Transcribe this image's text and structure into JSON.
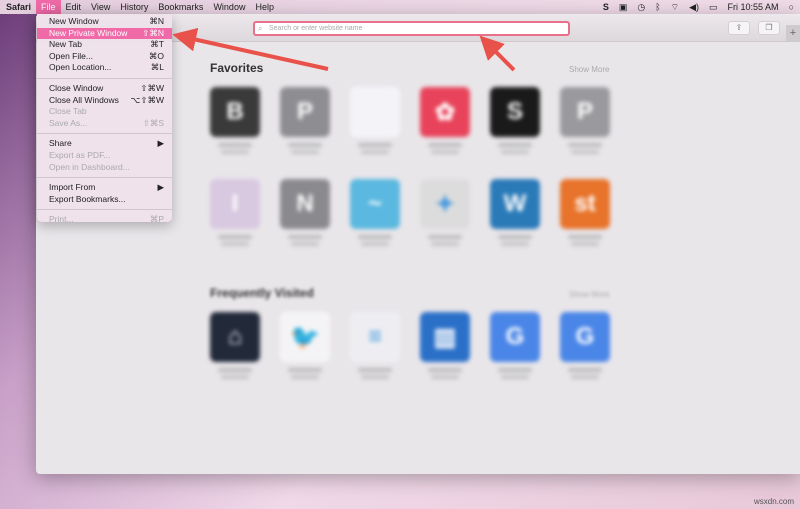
{
  "menubar": {
    "app": "Safari",
    "items": [
      "File",
      "Edit",
      "View",
      "History",
      "Bookmarks",
      "Window",
      "Help"
    ],
    "active": "File",
    "clock": "Fri 10:55 AM",
    "status_icons": [
      "skype-icon",
      "battery-indicator-icon",
      "time-machine-icon",
      "bluetooth-icon",
      "wifi-icon",
      "volume-icon",
      "battery-icon"
    ]
  },
  "file_menu": {
    "groups": [
      [
        {
          "label": "New Window",
          "shortcut": "⌘N"
        },
        {
          "label": "New Private Window",
          "shortcut": "⇧⌘N",
          "highlighted": true
        },
        {
          "label": "New Tab",
          "shortcut": "⌘T"
        },
        {
          "label": "Open File...",
          "shortcut": "⌘O"
        },
        {
          "label": "Open Location...",
          "shortcut": "⌘L"
        }
      ],
      [
        {
          "label": "Close Window",
          "shortcut": "⇧⌘W"
        },
        {
          "label": "Close All Windows",
          "shortcut": "⌥⇧⌘W"
        },
        {
          "label": "Close Tab",
          "shortcut": "",
          "disabled": true
        },
        {
          "label": "Save As...",
          "shortcut": "⇧⌘S",
          "disabled": true
        }
      ],
      [
        {
          "label": "Share",
          "shortcut": "▶"
        },
        {
          "label": "Export as PDF...",
          "shortcut": "",
          "disabled": true
        },
        {
          "label": "Open in Dashboard...",
          "shortcut": "",
          "disabled": true
        }
      ],
      [
        {
          "label": "Import From",
          "shortcut": "▶"
        },
        {
          "label": "Export Bookmarks...",
          "shortcut": ""
        }
      ],
      [
        {
          "label": "Print...",
          "shortcut": "⌘P",
          "disabled": true
        }
      ]
    ]
  },
  "toolbar": {
    "search_placeholder": "Search or enter website name",
    "share_icon": "share-icon",
    "tabs_icon": "tabs-overview-icon",
    "new_tab": "+"
  },
  "favorites": {
    "title": "Favorites",
    "show_more": "Show More",
    "tiles": [
      {
        "letter": "B",
        "color": "#3a3a3a"
      },
      {
        "letter": "P",
        "color": "#8e8e92"
      },
      {
        "letter": "",
        "color": "#f4f4f8"
      },
      {
        "letter": "✿",
        "color": "#e8435a"
      },
      {
        "letter": "S",
        "color": "#1a1a1a"
      },
      {
        "letter": "P",
        "color": "#9a9a9e"
      },
      {
        "letter": "I",
        "color": "#d8c8e0"
      },
      {
        "letter": "N",
        "color": "#8a8a8e"
      },
      {
        "letter": "~",
        "color": "#5bb8e0"
      },
      {
        "letter": "✦",
        "color": "#dcdcdc"
      },
      {
        "letter": "W",
        "color": "#2a7ab8"
      },
      {
        "letter": "st",
        "color": "#e8732a"
      }
    ]
  },
  "frequently_visited": {
    "title": "Frequently Visited",
    "show_more": "Show More",
    "tiles": [
      {
        "letter": "⌂",
        "color": "#222a3a"
      },
      {
        "letter": "🐦",
        "color": "#f4f4f6"
      },
      {
        "letter": "≡",
        "color": "#eeeef2"
      },
      {
        "letter": "▥",
        "color": "#2a70c8"
      },
      {
        "letter": "G",
        "color": "#4a86e8"
      },
      {
        "letter": "G",
        "color": "#4a86e8"
      }
    ]
  },
  "accent": "#f06aa8",
  "arrow_color": "#e8524a",
  "watermark": "wsxdn.com"
}
